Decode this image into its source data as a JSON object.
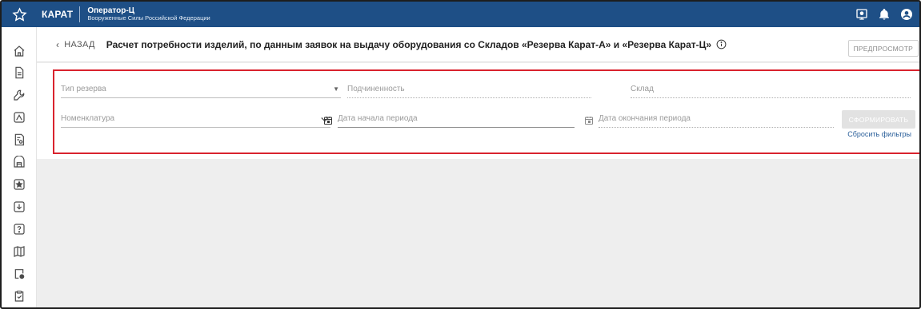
{
  "header": {
    "brand": "КАРАТ",
    "org_name": "Оператор-Ц",
    "org_subtitle": "Вооруженные Силы Российской Федерации",
    "icons": [
      "star-icon",
      "monitor-icon",
      "bell-icon",
      "user-icon"
    ]
  },
  "sidebar": {
    "items": [
      {
        "name": "home-icon"
      },
      {
        "name": "document-icon"
      },
      {
        "name": "wrench-icon"
      },
      {
        "name": "map-icon"
      },
      {
        "name": "calculator-icon"
      },
      {
        "name": "warehouse-icon"
      },
      {
        "name": "star-badge-icon"
      },
      {
        "name": "download-icon"
      },
      {
        "name": "help-icon"
      },
      {
        "name": "book-icon"
      },
      {
        "name": "settings-doc-icon"
      },
      {
        "name": "clipboard-icon"
      }
    ]
  },
  "titlebar": {
    "back_label": "НАЗАД",
    "title": "Расчет потребности изделий, по данным заявок на выдачу оборудования со Складов «Резерва Карат-А» и «Резерва Карат-Ц»",
    "preview_label": "ПРЕДПРОСМОТР"
  },
  "filters": {
    "reserve_type": {
      "placeholder": "Тип резерва"
    },
    "subordination": {
      "placeholder": "Подчиненность"
    },
    "warehouse": {
      "placeholder": "Склад"
    },
    "nomenclature": {
      "placeholder": "Номенклатура"
    },
    "date_start": {
      "placeholder": "Дата начала периода"
    },
    "date_end": {
      "placeholder": "Дата окончания периода"
    },
    "submit_label": "СФОРМИРОВАТЬ",
    "reset_label": "Сбросить фильтры"
  },
  "colors": {
    "header_bg": "#1e4f86",
    "highlight": "#d9232e",
    "link": "#2a5f9a"
  }
}
